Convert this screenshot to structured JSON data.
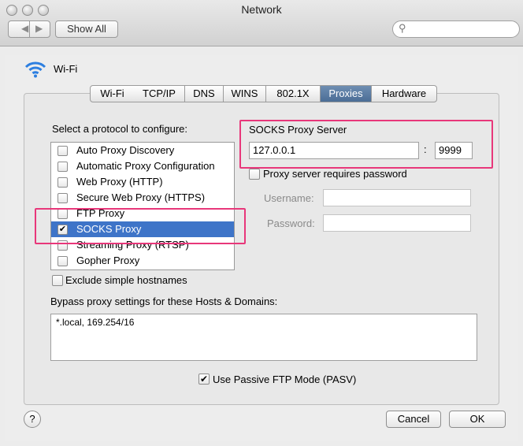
{
  "window": {
    "title": "Network",
    "show_all": "Show All"
  },
  "service": {
    "name": "Wi-Fi"
  },
  "tabs": [
    "Wi-Fi",
    "TCP/IP",
    "DNS",
    "WINS",
    "802.1X",
    "Proxies",
    "Hardware"
  ],
  "selected_tab": "Proxies",
  "protocols": {
    "heading": "Select a protocol to configure:",
    "items": [
      {
        "label": "Auto Proxy Discovery",
        "checked": false
      },
      {
        "label": "Automatic Proxy Configuration",
        "checked": false
      },
      {
        "label": "Web Proxy (HTTP)",
        "checked": false
      },
      {
        "label": "Secure Web Proxy (HTTPS)",
        "checked": false
      },
      {
        "label": "FTP Proxy",
        "checked": false
      },
      {
        "label": "SOCKS Proxy",
        "checked": true,
        "selected": true
      },
      {
        "label": "Streaming Proxy (RTSP)",
        "checked": false
      },
      {
        "label": "Gopher Proxy",
        "checked": false
      }
    ]
  },
  "server": {
    "heading": "SOCKS Proxy Server",
    "host": "127.0.0.1",
    "separator": ":",
    "port": "9999",
    "requires_password": "Proxy server requires password",
    "username_label": "Username:",
    "password_label": "Password:"
  },
  "exclude_simple": "Exclude simple hostnames",
  "bypass": {
    "label": "Bypass proxy settings for these Hosts & Domains:",
    "value": "*.local, 169.254/16"
  },
  "passive_ftp": "Use Passive FTP Mode (PASV)",
  "buttons": {
    "help": "?",
    "cancel": "Cancel",
    "ok": "OK"
  },
  "colors": {
    "highlight": "#e8377a",
    "selection": "#3e74c8",
    "tab_selected": "#5a7ca4"
  }
}
